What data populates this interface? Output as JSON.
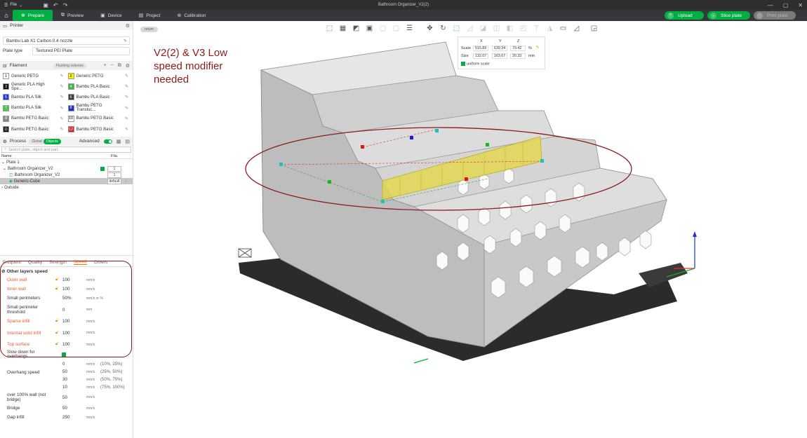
{
  "titlebar": {
    "menu_label": "File",
    "window_title": "Bathroom Organizer_V2(2)"
  },
  "menubar": {
    "tabs": [
      {
        "label": "Prepare",
        "icon": "prepare-icon"
      },
      {
        "label": "Preview",
        "icon": "preview-icon"
      },
      {
        "label": "Device",
        "icon": "device-icon"
      },
      {
        "label": "Project",
        "icon": "project-icon"
      },
      {
        "label": "Calibration",
        "icon": "calibration-icon"
      }
    ],
    "upload": "Upload",
    "slice_plate": "Slice plate",
    "print_plate": "Print plate"
  },
  "printer": {
    "section_title": "Printer",
    "name": "Bambu Lab X1 Carbon 0.4 nozzle",
    "plate_type_label": "Plate type",
    "plate_type": "Textured PEI Plate"
  },
  "filament": {
    "section_title": "Filament",
    "flushing_label": "Flushing volumes",
    "items": [
      {
        "num": "1",
        "name": "Generic PETG",
        "color": "#ffffff",
        "text": "#000000"
      },
      {
        "num": "2",
        "name": "Generic PETG",
        "color": "#f5f500",
        "text": "#000000"
      },
      {
        "num": "3",
        "name": "Generic PLA High Spe...",
        "color": "#111111",
        "text": "#ffffff"
      },
      {
        "num": "4",
        "name": "Bambu PLA Basic",
        "color": "#3cb83c",
        "text": "#ffffff"
      },
      {
        "num": "5",
        "name": "Bambu PLA Silk",
        "color": "#1a3ad8",
        "text": "#ffffff"
      },
      {
        "num": "6",
        "name": "Bambu PLA Basic",
        "color": "#3c3c3c",
        "text": "#ffffff"
      },
      {
        "num": "7",
        "name": "Bambu PLA Silk",
        "color": "#48c848",
        "text": "#ffffff"
      },
      {
        "num": "8",
        "name": "Bambu PETG Transluc...",
        "color": "#1e2ec8",
        "text": "#ffffff"
      },
      {
        "num": "9",
        "name": "Bambu PETG Basic",
        "color": "#8a8a8a",
        "text": "#ffffff"
      },
      {
        "num": "10",
        "name": "Bambu PETG Basic",
        "color": "#ffffff",
        "text": "#000000"
      },
      {
        "num": "11",
        "name": "Bambu PETG Basic",
        "color": "#111111",
        "text": "#ffffff"
      },
      {
        "num": "12",
        "name": "Bambu PETG Basic",
        "color": "#d81e1e",
        "text": "#ffffff"
      }
    ]
  },
  "process": {
    "section_title": "Process",
    "global_label": "Global",
    "objects_label": "Objects",
    "advanced_label": "Advanced",
    "search_placeholder": "Search plate, object and part.",
    "col_name": "Name",
    "col_fila": "Fila.",
    "tree": {
      "plate": "Plate 1",
      "object": "Bathroom Organizer_V2",
      "object_fila": "1",
      "part": "Bathroom Organizer_V2",
      "part_fila": "1",
      "modifier": "Generic-Cube",
      "modifier_fila": "default",
      "outside": "Outside"
    }
  },
  "settings": {
    "tabs": [
      "Frequent",
      "Quality",
      "Strength",
      "Speed",
      "Others"
    ],
    "group_title": "Other layers speed",
    "rows": [
      {
        "label": "Outer wall",
        "value": "100",
        "unit": "mm/s",
        "modified": true
      },
      {
        "label": "Inner wall",
        "value": "100",
        "unit": "mm/s",
        "modified": true
      },
      {
        "label": "Small perimeters",
        "value": "50%",
        "unit": "mm/s or %",
        "modified": false
      },
      {
        "label": "Small perimeter threshold",
        "value": "0",
        "unit": "mm",
        "modified": false
      },
      {
        "label": "Sparse infill",
        "value": "100",
        "unit": "mm/s",
        "modified": true
      },
      {
        "label": "Internal solid infill",
        "value": "100",
        "unit": "mm/s",
        "modified": true
      },
      {
        "label": "Top surface",
        "value": "100",
        "unit": "mm/s",
        "modified": true
      }
    ],
    "slow_down_label": "Slow down for overhangs",
    "overhang_label": "Overhang speed",
    "overhang_rows": [
      {
        "value": "0",
        "unit": "mm/s",
        "range": "(10%, 25%)"
      },
      {
        "value": "50",
        "unit": "mm/s",
        "range": "(25%, 50%)"
      },
      {
        "value": "30",
        "unit": "mm/s",
        "range": "(50%, 75%)"
      },
      {
        "value": "10",
        "unit": "mm/s",
        "range": "(75%, 100%)"
      }
    ],
    "over100_label": "over 100% wall (not bridge)",
    "over100_value": "50",
    "bridge_label": "Bridge",
    "bridge_value": "50",
    "gap_label": "Gap infill",
    "gap_value": "250",
    "unit": "mm/s"
  },
  "viewport": {
    "return_label": "return",
    "annotation": "V2(2) & V3 Low\nspeed modifier\nneeded",
    "scale_panel": {
      "x": "X",
      "y": "Y",
      "z": "Z",
      "scale_label": "Scale",
      "scale_x": "515.89",
      "scale_y": "639.34",
      "scale_z": "79.42",
      "scale_unit": "%",
      "size_label": "Size",
      "size_x": "132.07",
      "size_y": "163.67",
      "size_z": "20.33",
      "size_unit": "mm",
      "uniform_label": "uniform scale"
    }
  },
  "colors": {
    "accent": "#00ae42",
    "modified": "#f05a28",
    "annotation": "#8b1a1a"
  }
}
